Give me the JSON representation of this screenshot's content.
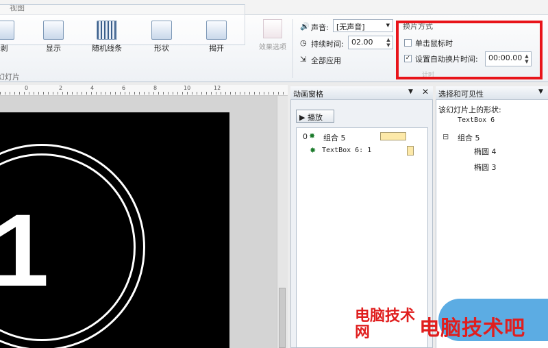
{
  "tabs": {
    "view": "视图"
  },
  "ribbon": {
    "effects": [
      {
        "label": "剥",
        "icon": "wipe-effect-icon"
      },
      {
        "label": "显示",
        "icon": "reveal-effect-icon"
      },
      {
        "label": "随机线条",
        "icon": "random-bars-effect-icon"
      },
      {
        "label": "形状",
        "icon": "shape-effect-icon"
      },
      {
        "label": "揭开",
        "icon": "uncover-effect-icon"
      }
    ],
    "effect_options": "效果选项",
    "group_label": "幻灯片",
    "sound_label": "声音:",
    "sound_value": "[无声音]",
    "duration_label": "持续时间:",
    "duration_value": "02.00",
    "apply_all": "全部应用",
    "advance_title": "换片方式",
    "on_click_label": "单击鼠标时",
    "on_click_checked": false,
    "auto_label": "设置自动换片时间:",
    "auto_checked": true,
    "auto_value": "00:00.00",
    "timing_label": "计时"
  },
  "ruler": {
    "ticks": [
      "0",
      "2",
      "4",
      "6",
      "8",
      "10",
      "12"
    ]
  },
  "slide": {
    "number": "1"
  },
  "animation_pane": {
    "title": "动画窗格",
    "play_label": "播放",
    "items": [
      {
        "index": "0",
        "label": "组合 5"
      },
      {
        "index": "",
        "label": "TextBox 6: 1"
      }
    ]
  },
  "selection_pane": {
    "title": "选择和可见性",
    "subtitle": "该幻灯片上的形状:",
    "items": [
      {
        "label": "TextBox 6"
      },
      {
        "label": "组合 5",
        "expander": "⊟"
      },
      {
        "label": "椭圆 4"
      },
      {
        "label": "椭圆 3"
      }
    ]
  },
  "watermark": {
    "small": "电脑技术网",
    "large": "电脑技术吧"
  },
  "colors": {
    "highlight": "#e8141a",
    "watermark": "#e01e1e",
    "watermark_badge": "#4aa3e0"
  }
}
